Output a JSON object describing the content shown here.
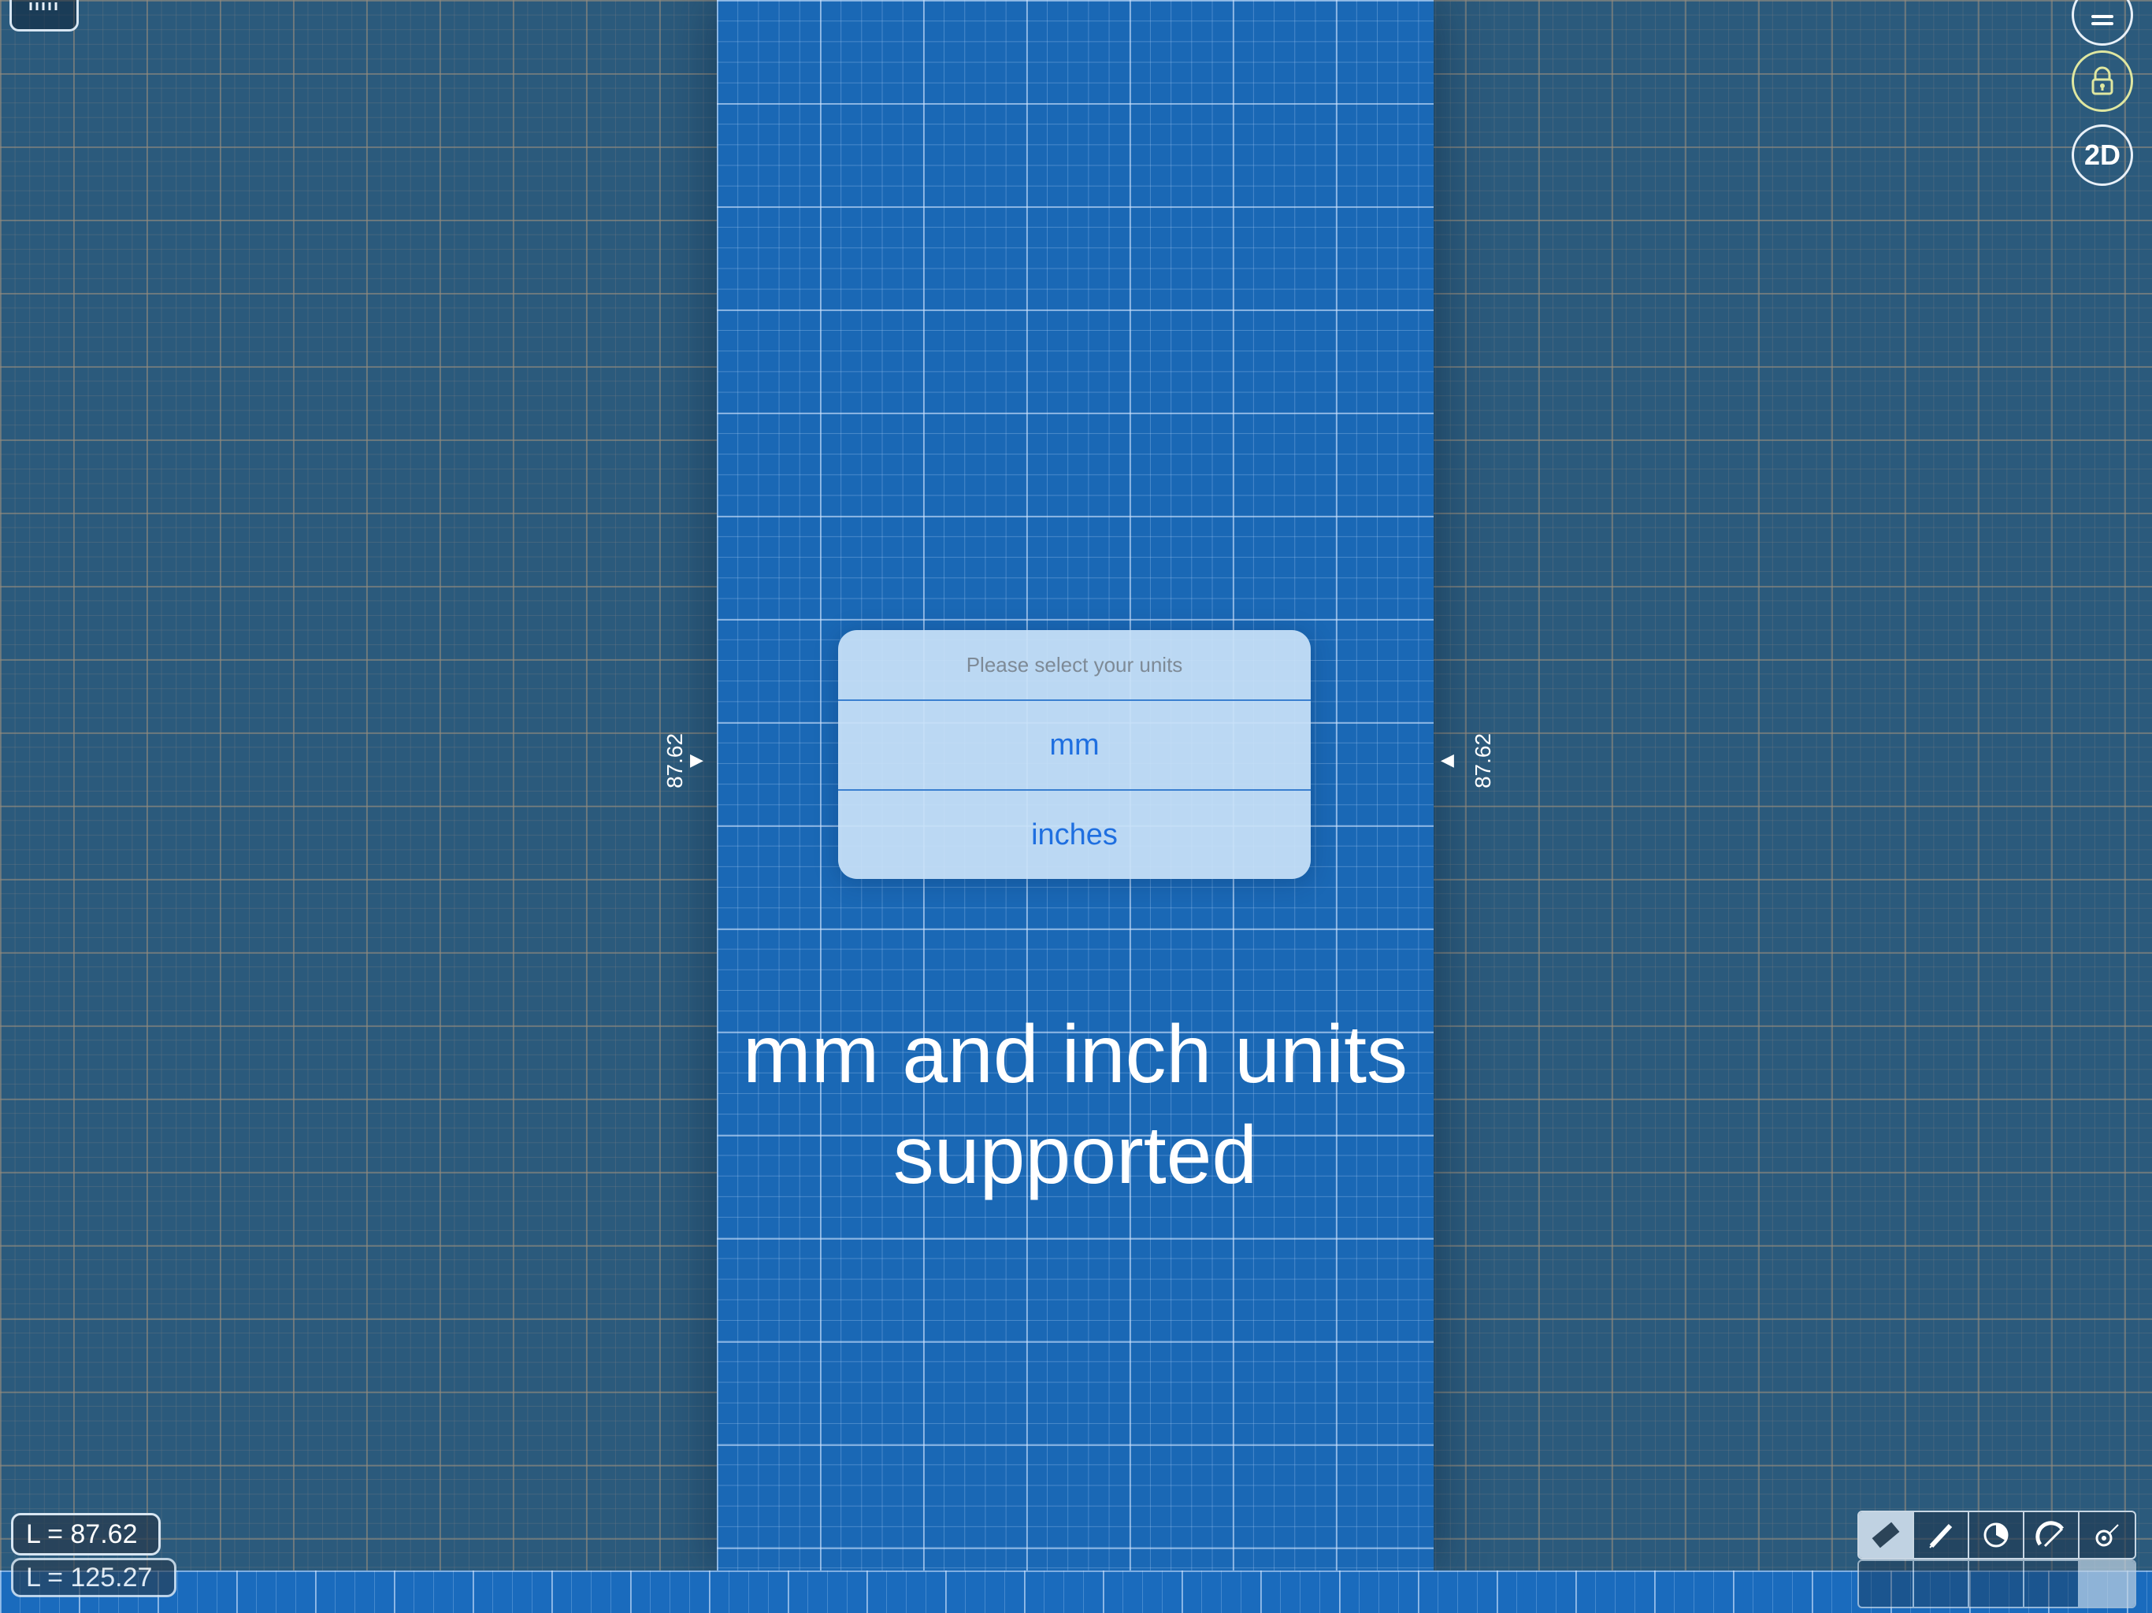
{
  "canvas": {
    "left_marker_value": "87.62",
    "right_marker_value": "87.62",
    "left_marker_arrow": "▶",
    "right_marker_arrow": "◀"
  },
  "dialog": {
    "title": "Please select your units",
    "options": [
      {
        "label": "mm"
      },
      {
        "label": "inches"
      }
    ]
  },
  "caption": {
    "line1": "mm and inch units",
    "line2": "supported"
  },
  "top_right": {
    "menu_icon": "menu-icon",
    "lock_icon": "lock-icon",
    "mode_label": "2D"
  },
  "readouts": {
    "main": "L = 87.62",
    "ghost": "L = 125.27"
  },
  "toolbar": {
    "tools": [
      "ruler-icon",
      "pencil-icon",
      "protractor-icon",
      "angle-ruler-icon",
      "tape-measure-icon"
    ],
    "active_index": 0
  },
  "colors": {
    "background": "#2b5a7c",
    "strip": "#1a68b5",
    "dialog": "#c8e1f8",
    "dialog_text": "#1f6fe0"
  }
}
